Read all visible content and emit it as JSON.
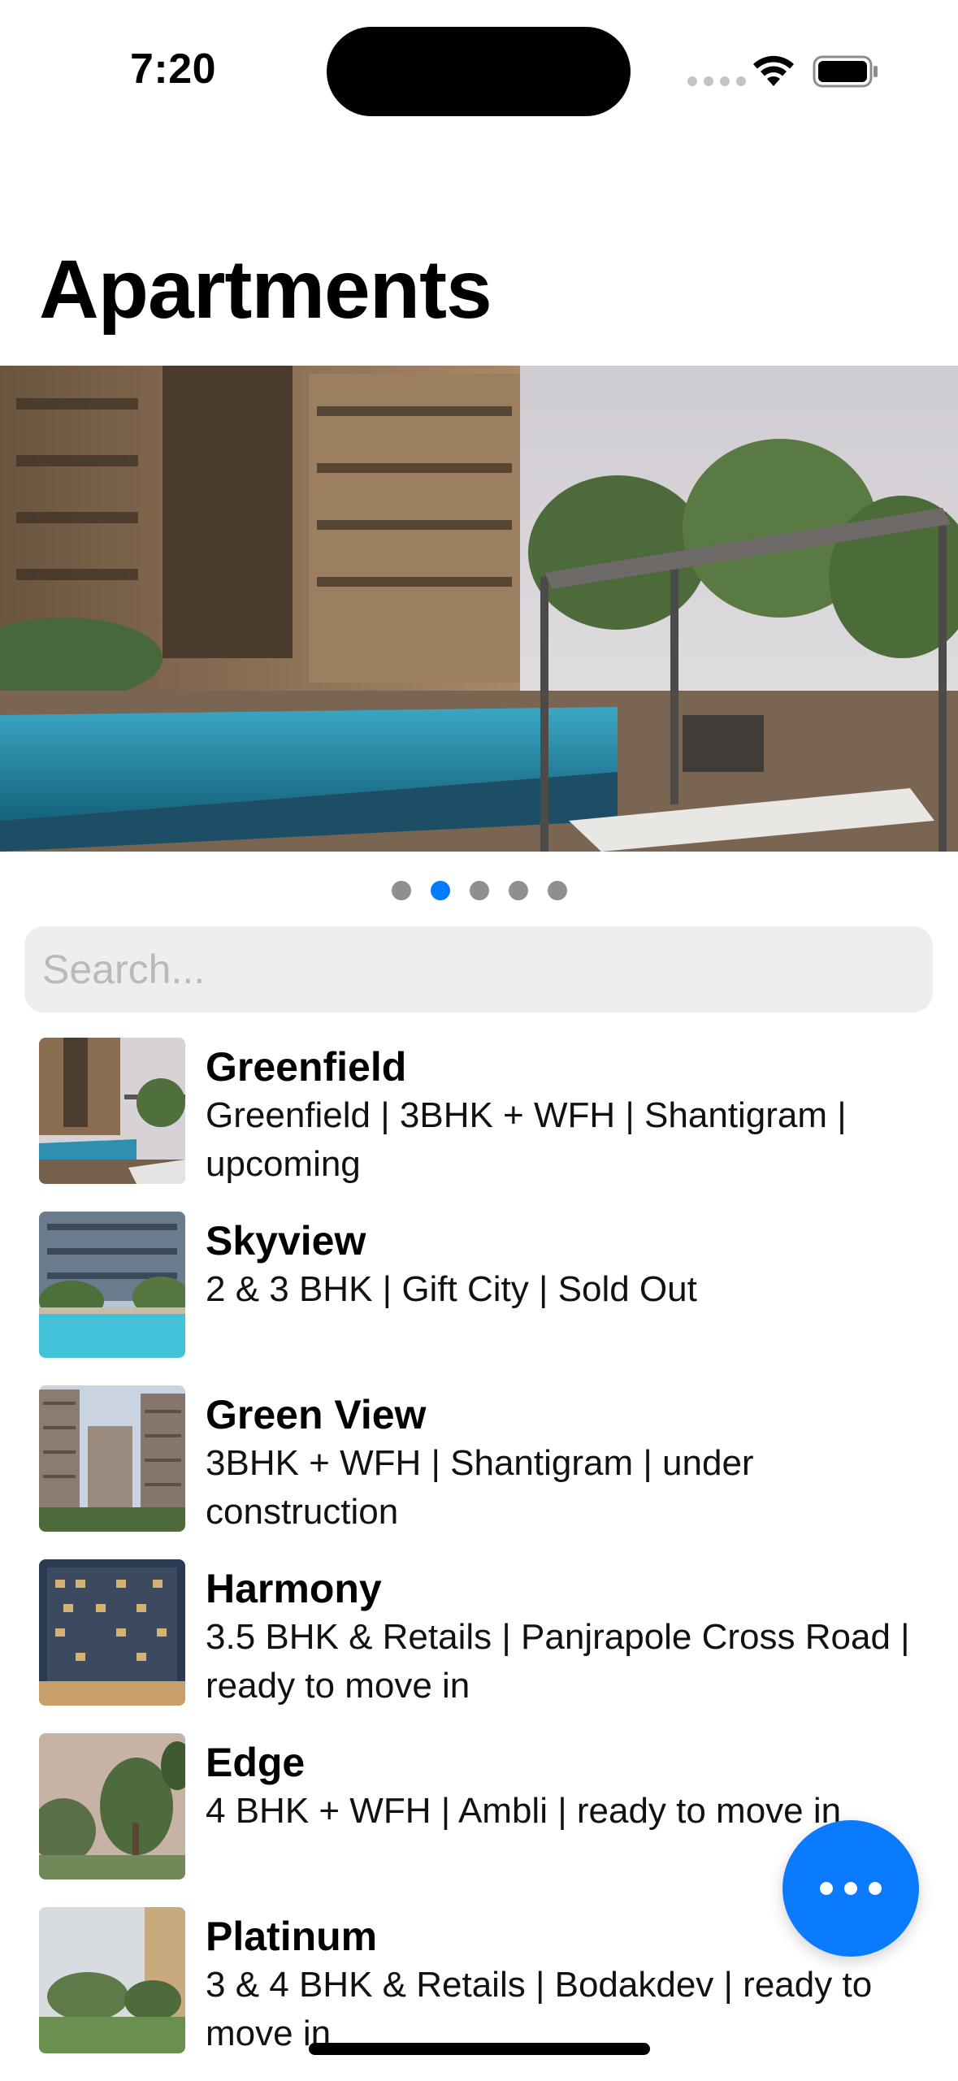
{
  "status_bar": {
    "time": "7:20"
  },
  "page": {
    "title": "Apartments"
  },
  "carousel": {
    "page_count": 5,
    "active_index": 1
  },
  "search": {
    "placeholder": "Search...",
    "value": ""
  },
  "apartments": [
    {
      "name": "Greenfield",
      "details": "Greenfield | 3BHK + WFH | Shantigram | upcoming"
    },
    {
      "name": "Skyview",
      "details": "2 & 3 BHK | Gift City | Sold Out"
    },
    {
      "name": "Green View",
      "details": "3BHK + WFH | Shantigram | under construction"
    },
    {
      "name": "Harmony",
      "details": "3.5 BHK & Retails | Panjrapole Cross Road | ready to move in"
    },
    {
      "name": "Edge",
      "details": "4 BHK + WFH | Ambli | ready to move in"
    },
    {
      "name": "Platinum",
      "details": "3 & 4 BHK & Retails | Bodakdev | ready to move in"
    }
  ],
  "icons": {
    "wifi": "wifi-icon",
    "battery": "battery-icon",
    "more": "ellipsis-icon"
  },
  "colors": {
    "accent": "#007AFF",
    "fab": "#0A7BFF",
    "inactive_dot": "#8E8E93",
    "search_bg": "#EEEEF0"
  }
}
